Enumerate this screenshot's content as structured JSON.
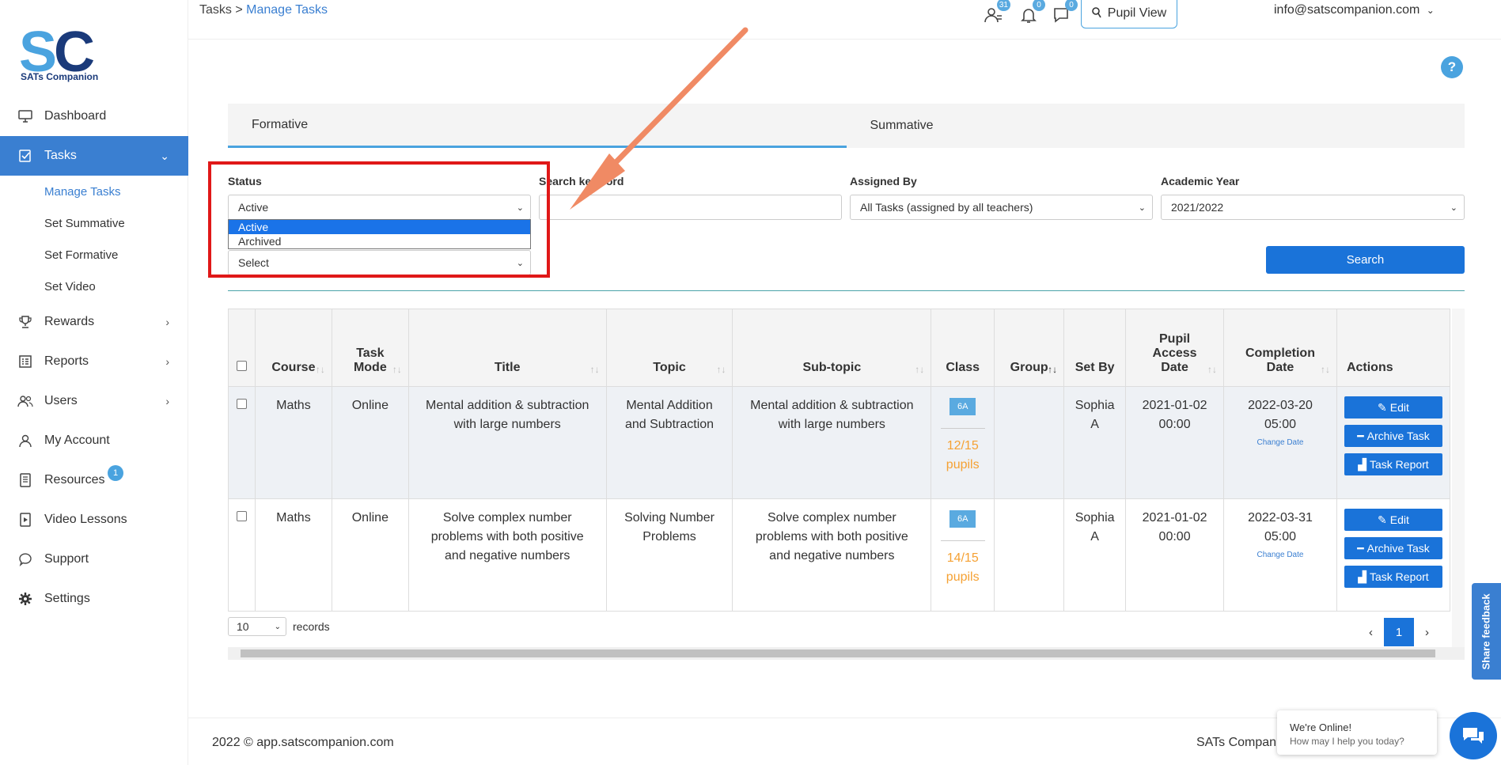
{
  "brand": {
    "name": "SATs Companion"
  },
  "sidebar": {
    "items": [
      {
        "label": "Dashboard",
        "icon": "monitor-icon"
      },
      {
        "label": "Tasks",
        "icon": "tasks-icon",
        "active": true
      },
      {
        "label": "Rewards",
        "icon": "trophy-icon"
      },
      {
        "label": "Reports",
        "icon": "reports-icon"
      },
      {
        "label": "Users",
        "icon": "users-icon"
      },
      {
        "label": "My Account",
        "icon": "account-icon"
      },
      {
        "label": "Resources",
        "icon": "resources-icon",
        "badge": "1"
      },
      {
        "label": "Video Lessons",
        "icon": "video-icon"
      },
      {
        "label": "Support",
        "icon": "support-icon"
      },
      {
        "label": "Settings",
        "icon": "gear-icon"
      }
    ],
    "task_sub": [
      "Manage Tasks",
      "Set Summative",
      "Set Formative",
      "Set Video"
    ]
  },
  "header": {
    "crumb_root": "Tasks",
    "crumb_sep": ">",
    "crumb_current": "Manage Tasks",
    "pupil_view": "Pupil View",
    "users_badge": "31",
    "bell_badge": "0",
    "chat_badge": "0",
    "email": "info@satscompanion.com"
  },
  "help": "?",
  "tabs": [
    "Formative",
    "Summative"
  ],
  "filters": {
    "status_label": "Status",
    "status_value": "Active",
    "status_options": [
      "Active",
      "Archived"
    ],
    "course_value": "Select",
    "keyword_label": "Search keyword",
    "assigned_label": "Assigned By",
    "assigned_value": "All Tasks (assigned by all teachers)",
    "year_label": "Academic Year",
    "year_value": "2021/2022",
    "search_button": "Search"
  },
  "table": {
    "headers": [
      "Course",
      "Task Mode",
      "Title",
      "Topic",
      "Sub-topic",
      "Class",
      "Group",
      "Set By",
      "Pupil Access Date",
      "Completion Date",
      "Actions"
    ],
    "rows": [
      {
        "course": "Maths",
        "mode": "Online",
        "title": "Mental addition & subtraction with large numbers",
        "topic": "Mental Addition and Subtraction",
        "subtopic": "Mental addition & subtraction with large numbers",
        "class": "6A",
        "pupils": "12/15 pupils",
        "group": "",
        "set_by": "Sophia A",
        "access_date": "2021-01-02 00:00",
        "completion_date": "2022-03-20 05:00",
        "change_date": "Change Date"
      },
      {
        "course": "Maths",
        "mode": "Online",
        "title": "Solve complex number problems with both positive and negative numbers",
        "topic": "Solving Number Problems",
        "subtopic": "Solve complex number problems with both positive and negative numbers",
        "class": "6A",
        "pupils": "14/15 pupils",
        "group": "",
        "set_by": "Sophia A",
        "access_date": "2021-01-02 00:00",
        "completion_date": "2022-03-31 05:00",
        "change_date": "Change Date"
      }
    ],
    "actions": {
      "edit": "Edit",
      "archive": "Archive Task",
      "report": "Task Report"
    }
  },
  "records": {
    "value": "10",
    "label": "records"
  },
  "pager": {
    "prev": "‹",
    "page": "1",
    "next": "›"
  },
  "footer": {
    "copy": "2022 © app.satscompanion.com",
    "brand": "SATs Compan"
  },
  "chat": {
    "title": "We're Online!",
    "subtitle": "How may I help you today?"
  },
  "feedback": "Share feedback",
  "colors": {
    "accent": "#3a7fd1",
    "primary_button": "#1a73d9",
    "highlight_box": "#e01818",
    "arrow": "#f08a64",
    "pupils": "#f5a133"
  }
}
